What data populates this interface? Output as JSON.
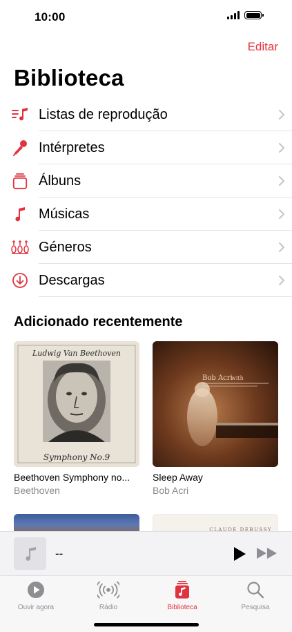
{
  "status": {
    "time": "10:00"
  },
  "header": {
    "edit_label": "Editar",
    "title": "Biblioteca"
  },
  "library_items": [
    {
      "label": "Listas de reprodução",
      "icon": "playlist-icon"
    },
    {
      "label": "Intérpretes",
      "icon": "microphone-icon"
    },
    {
      "label": "Álbuns",
      "icon": "album-stack-icon"
    },
    {
      "label": "Músicas",
      "icon": "music-note-icon"
    },
    {
      "label": "Géneros",
      "icon": "genres-icon"
    },
    {
      "label": "Descargas",
      "icon": "download-icon"
    }
  ],
  "recent": {
    "title": "Adicionado recentemente",
    "albums": [
      {
        "title": "Beethoven Symphony no...",
        "artist": "Beethoven",
        "cover_top_text": "Ludwig Van Beethoven",
        "cover_bottom_text": "Symphony No.9"
      },
      {
        "title": "Sleep Away",
        "artist": "Bob Acri",
        "cover_name": "Bob Acri",
        "cover_with": "with"
      }
    ],
    "row2_cover_text": "CLAUDE DEBUSSY"
  },
  "mini_player": {
    "title": "--"
  },
  "tabs": [
    {
      "label": "Ouvir agora",
      "icon": "play-circle-icon"
    },
    {
      "label": "Rádio",
      "icon": "radio-icon"
    },
    {
      "label": "Biblioteca",
      "icon": "library-icon"
    },
    {
      "label": "Pesquisa",
      "icon": "search-icon"
    }
  ],
  "colors": {
    "accent": "#e0333f",
    "secondary_text": "#8a8a8e",
    "chevron": "#c5c5c7"
  }
}
